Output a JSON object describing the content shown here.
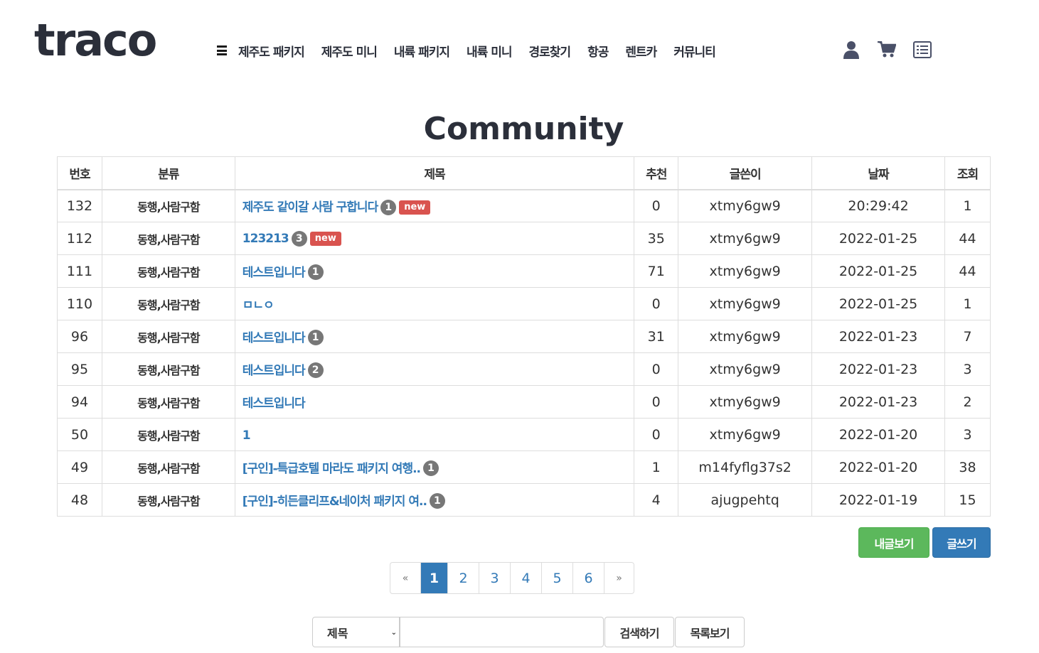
{
  "header": {
    "logo": "traco",
    "nav": [
      "제주도 패키지",
      "제주도 미니",
      "내륙 패키지",
      "내륙 미니",
      "경로찾기",
      "항공",
      "렌트카",
      "커뮤니티"
    ],
    "icons": [
      "user-icon",
      "cart-icon",
      "list-icon"
    ]
  },
  "page_title": "Community",
  "table": {
    "headers": [
      "번호",
      "분류",
      "제목",
      "추천",
      "글쓴이",
      "날짜",
      "조회"
    ],
    "rows": [
      {
        "no": "132",
        "category": "동행,사람구함",
        "title": "제주도 같이갈 사람 구합니다",
        "comments": "1",
        "is_new": true,
        "new_label": "new",
        "likes": "0",
        "author": "xtmy6gw9",
        "date": "20:29:42",
        "views": "1"
      },
      {
        "no": "112",
        "category": "동행,사람구함",
        "title": "123213",
        "comments": "3",
        "is_new": true,
        "new_label": "new",
        "likes": "35",
        "author": "xtmy6gw9",
        "date": "2022-01-25",
        "views": "44"
      },
      {
        "no": "111",
        "category": "동행,사람구함",
        "title": "테스트입니다",
        "comments": "1",
        "is_new": false,
        "likes": "71",
        "author": "xtmy6gw9",
        "date": "2022-01-25",
        "views": "44"
      },
      {
        "no": "110",
        "category": "동행,사람구함",
        "title": "ㅁㄴㅇ",
        "comments": "",
        "is_new": false,
        "likes": "0",
        "author": "xtmy6gw9",
        "date": "2022-01-25",
        "views": "1"
      },
      {
        "no": "96",
        "category": "동행,사람구함",
        "title": "테스트입니다",
        "comments": "1",
        "is_new": false,
        "likes": "31",
        "author": "xtmy6gw9",
        "date": "2022-01-23",
        "views": "7"
      },
      {
        "no": "95",
        "category": "동행,사람구함",
        "title": "테스트입니다",
        "comments": "2",
        "is_new": false,
        "likes": "0",
        "author": "xtmy6gw9",
        "date": "2022-01-23",
        "views": "3"
      },
      {
        "no": "94",
        "category": "동행,사람구함",
        "title": "테스트입니다",
        "comments": "",
        "is_new": false,
        "likes": "0",
        "author": "xtmy6gw9",
        "date": "2022-01-23",
        "views": "2"
      },
      {
        "no": "50",
        "category": "동행,사람구함",
        "title": "1",
        "comments": "",
        "is_new": false,
        "likes": "0",
        "author": "xtmy6gw9",
        "date": "2022-01-20",
        "views": "3"
      },
      {
        "no": "49",
        "category": "동행,사람구함",
        "title": "[구인]-특급호텔 마라도 패키지 여행..",
        "comments": "1",
        "is_new": false,
        "likes": "1",
        "author": "m14fyflg37s2",
        "date": "2022-01-20",
        "views": "38"
      },
      {
        "no": "48",
        "category": "동행,사람구함",
        "title": "[구인]-히든클리프&네이처 패키지 여..",
        "comments": "1",
        "is_new": false,
        "likes": "4",
        "author": "ajugpehtq",
        "date": "2022-01-19",
        "views": "15"
      }
    ]
  },
  "actions": {
    "my_posts": "내글보기",
    "write": "글쓰기"
  },
  "pagination": {
    "prev": "«",
    "next": "»",
    "pages": [
      "1",
      "2",
      "3",
      "4",
      "5",
      "6"
    ],
    "current": "1"
  },
  "search": {
    "field_selected": "제목",
    "query": "",
    "search_button": "검색하기",
    "list_button": "목록보기"
  },
  "colors": {
    "link": "#337ab7",
    "new": "#d9534f",
    "badge": "#777777",
    "green": "#5cb85c",
    "blue": "#337ab7"
  }
}
